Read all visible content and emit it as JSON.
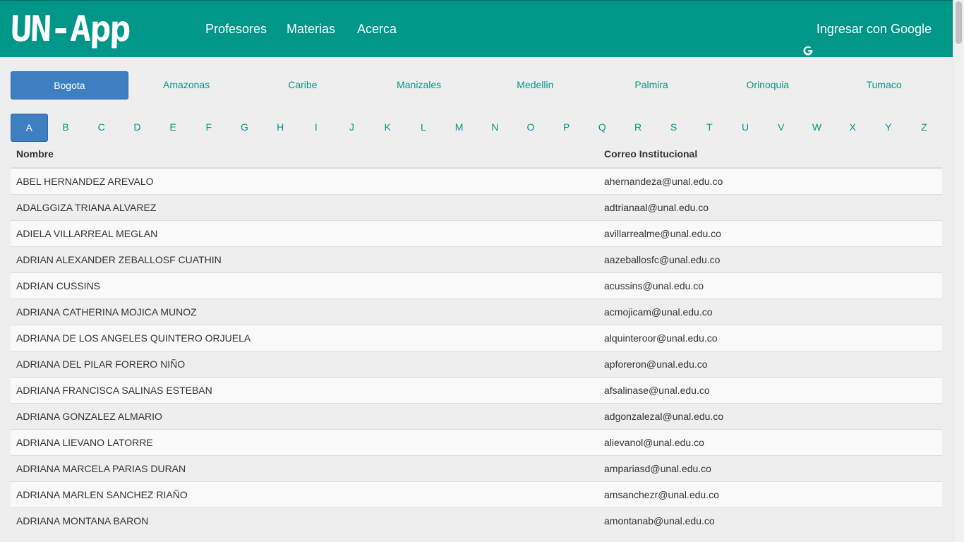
{
  "navbar": {
    "logo": "UN-App",
    "links": [
      "Profesores",
      "Materias",
      "Acerca"
    ],
    "login_label": "Ingresar con Google",
    "background": "#009688"
  },
  "campuses": {
    "active": "Bogota",
    "items": [
      "Bogota",
      "Amazonas",
      "Caribe",
      "Manizales",
      "Medellin",
      "Palmira",
      "Orinoquia",
      "Tumaco"
    ]
  },
  "letters": {
    "active": "A",
    "items": [
      "A",
      "B",
      "C",
      "D",
      "E",
      "F",
      "G",
      "H",
      "I",
      "J",
      "K",
      "L",
      "M",
      "N",
      "O",
      "P",
      "Q",
      "R",
      "S",
      "T",
      "U",
      "V",
      "W",
      "X",
      "Y",
      "Z"
    ]
  },
  "table": {
    "headers": [
      "Nombre",
      "Correo Institucional"
    ],
    "rows": [
      [
        "ABEL HERNANDEZ AREVALO",
        "ahernandeza@unal.edu.co"
      ],
      [
        "ADALGGIZA TRIANA ALVAREZ",
        "adtrianaal@unal.edu.co"
      ],
      [
        "ADIELA VILLARREAL MEGLAN",
        "avillarrealme@unal.edu.co"
      ],
      [
        "ADRIAN ALEXANDER ZEBALLOSF CUATHIN",
        "aazeballosfc@unal.edu.co"
      ],
      [
        "ADRIAN CUSSINS",
        "acussins@unal.edu.co"
      ],
      [
        "ADRIANA CATHERINA MOJICA MUNOZ",
        "acmojicam@unal.edu.co"
      ],
      [
        "ADRIANA DE LOS ANGELES QUINTERO ORJUELA",
        "alquinteroor@unal.edu.co"
      ],
      [
        "ADRIANA DEL PILAR FORERO NIÑO",
        "apforeron@unal.edu.co"
      ],
      [
        "ADRIANA FRANCISCA SALINAS ESTEBAN",
        "afsalinase@unal.edu.co"
      ],
      [
        "ADRIANA GONZALEZ ALMARIO",
        "adgonzalezal@unal.edu.co"
      ],
      [
        "ADRIANA LIEVANO LATORRE",
        "alievanol@unal.edu.co"
      ],
      [
        "ADRIANA MARCELA PARIAS DURAN",
        "ampariasd@unal.edu.co"
      ],
      [
        "ADRIANA MARLEN SANCHEZ RIAÑO",
        "amsanchezr@unal.edu.co"
      ],
      [
        "ADRIANA MONTANA BARON",
        "amontanab@unal.edu.co"
      ]
    ]
  }
}
